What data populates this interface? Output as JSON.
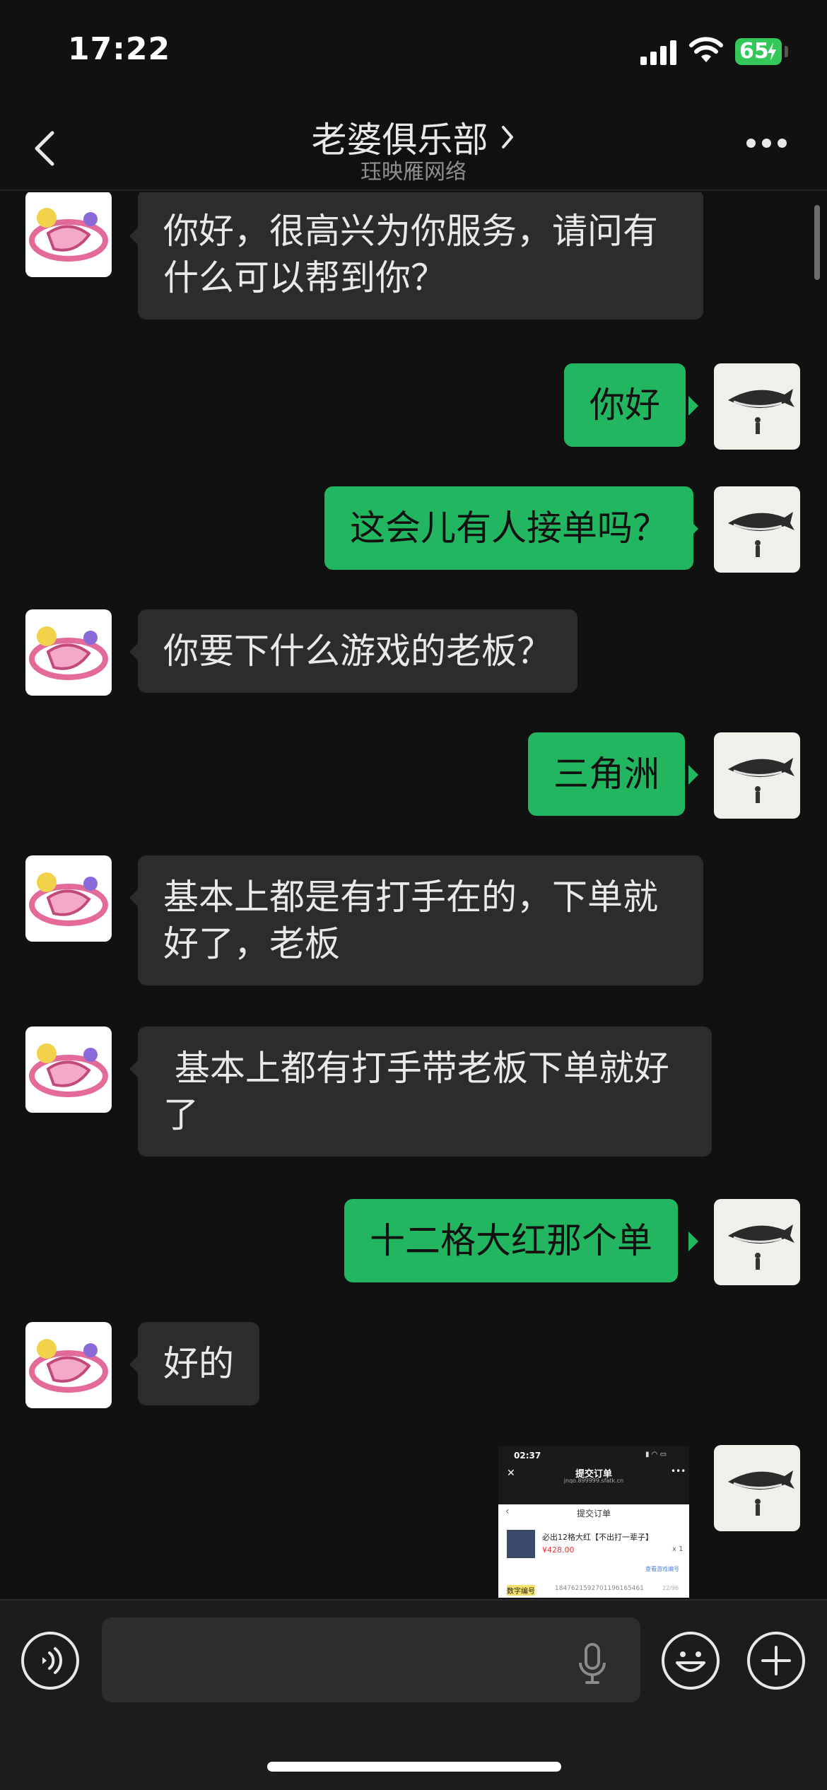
{
  "status_bar": {
    "time": "17:22",
    "battery": "65"
  },
  "header": {
    "title": "老婆俱乐部",
    "subtitle": "珏映雁网络"
  },
  "messages": [
    {
      "from": "other",
      "text": "你好，很高兴为你服务，请问有\n什么可以帮到你？"
    },
    {
      "from": "me",
      "text": "你好"
    },
    {
      "from": "me",
      "text": "这会儿有人接单吗？"
    },
    {
      "from": "other",
      "text": "你要下什么游戏的老板？"
    },
    {
      "from": "me",
      "text": "三角洲"
    },
    {
      "from": "other",
      "text": "基本上都是有打手在的，下单就\n好了，老板"
    },
    {
      "from": "other",
      "text": " 基本上都有打手带老板下单就好\n了"
    },
    {
      "from": "me",
      "text": "十二格大红那个单"
    },
    {
      "from": "other",
      "text": "好的"
    }
  ],
  "image_message": {
    "time": "02:37",
    "title": "提交订单",
    "url": "jnqo.899999.sfatk.cn",
    "subtitle": "提交订单",
    "item": "必出12格大红【不出打一辈子】",
    "price": "¥428.00",
    "qty": "x 1",
    "link": "查看游戏编号",
    "label": "数字编号",
    "number": "18476215927011961654​61",
    "count": "22/96"
  },
  "input_bar": {
    "placeholder": ""
  },
  "icons": {
    "back": "chevron-left-icon",
    "more": "more-dots-icon",
    "voice": "voice-icon",
    "mic": "microphone-icon",
    "emoji": "emoji-icon",
    "plus": "plus-icon"
  },
  "colors": {
    "my_bubble": "#23b660",
    "their_bubble": "#2c2c2c",
    "background": "#111111"
  }
}
